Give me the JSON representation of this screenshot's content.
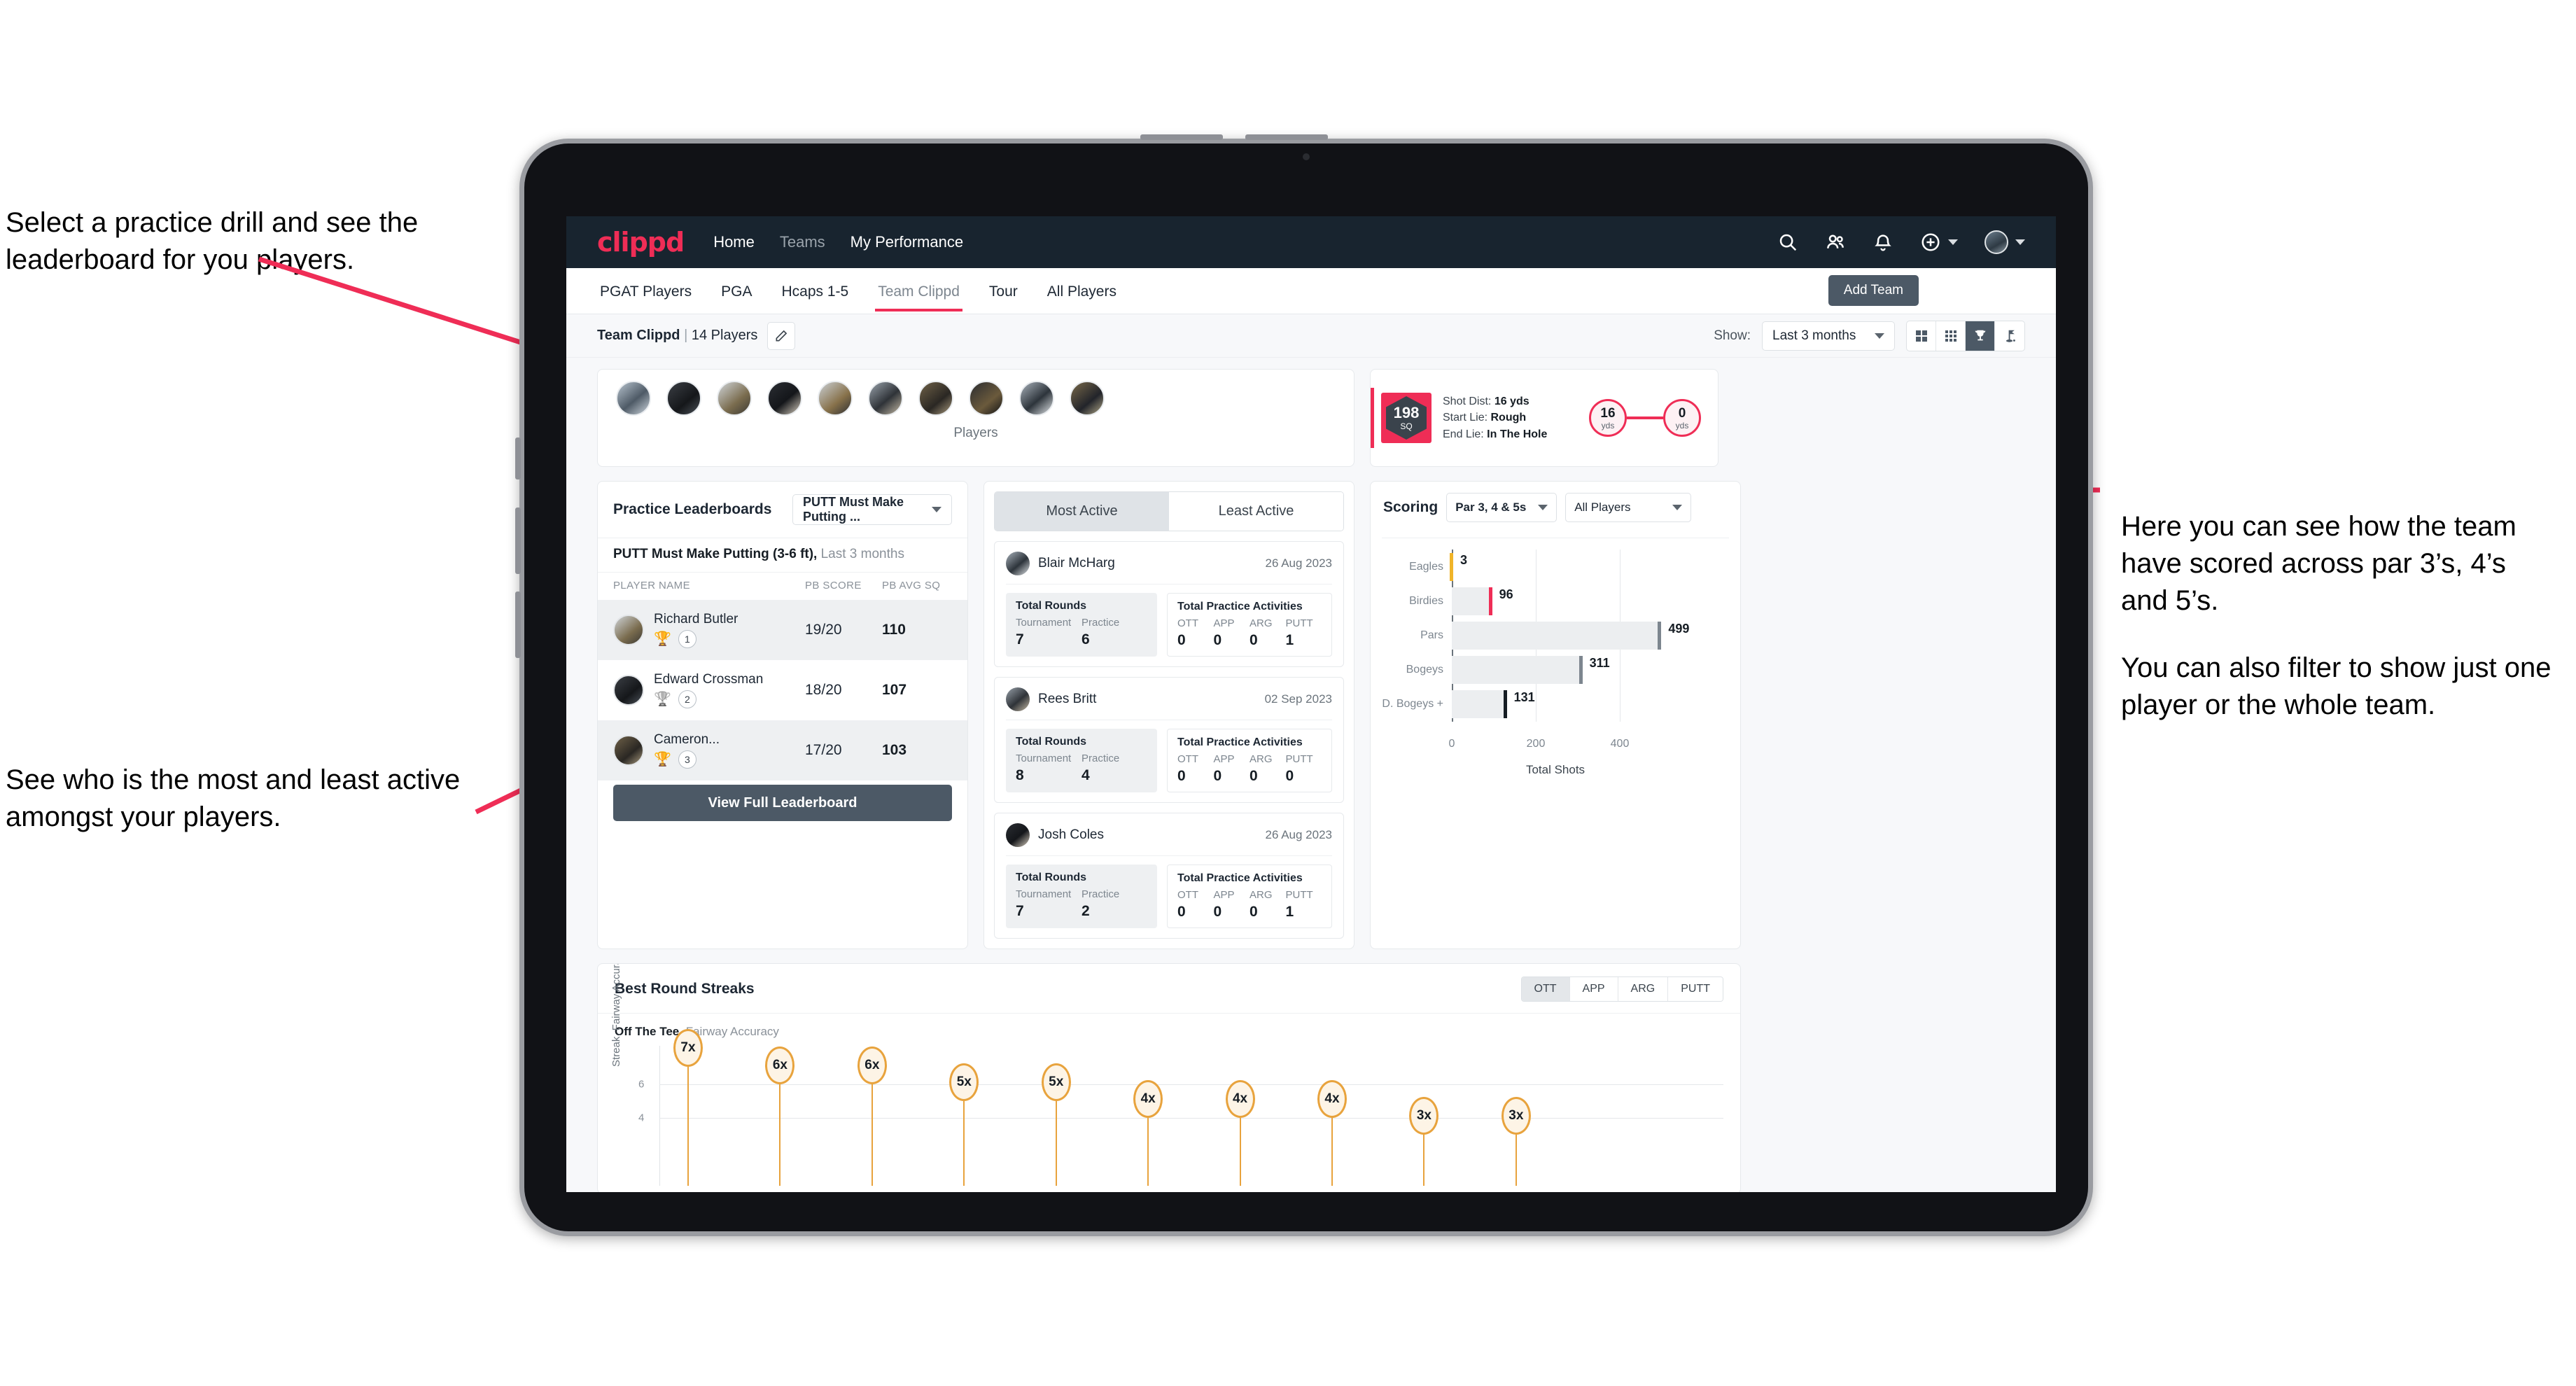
{
  "annotations": {
    "left_top": "Select a practice drill and see the leaderboard for you players.",
    "left_bottom": "See who is the most and least active amongst your players.",
    "right_1": "Here you can see how the team have scored across par 3’s, 4’s and 5’s.",
    "right_2": "You can also filter to show just one player or the whole team."
  },
  "topnav": {
    "logo": "clippd",
    "links": [
      {
        "label": "Home",
        "active": true
      },
      {
        "label": "Teams",
        "active": false
      },
      {
        "label": "My Performance",
        "active": true
      }
    ],
    "icons": [
      "search-icon",
      "people-icon",
      "bell-icon",
      "plus-circle-icon",
      "avatar"
    ]
  },
  "tabs": [
    {
      "label": "PGAT Players",
      "active": false
    },
    {
      "label": "PGA",
      "active": false
    },
    {
      "label": "Hcaps 1-5",
      "active": false
    },
    {
      "label": "Team Clippd",
      "active": true
    },
    {
      "label": "Tour",
      "active": false
    },
    {
      "label": "All Players",
      "active": false
    }
  ],
  "add_team_button": "Add Team",
  "subbar": {
    "team_name": "Team Clippd",
    "separator": "|",
    "player_count": "14 Players",
    "edit_icon": "pencil-icon",
    "show_label": "Show:",
    "range_value": "Last 3 months",
    "view_modes": [
      {
        "icon": "grid-2x2-icon",
        "active": false
      },
      {
        "icon": "grid-3x3-icon",
        "active": false
      },
      {
        "icon": "trophy-icon",
        "active": true
      },
      {
        "icon": "golf-flag-icon",
        "active": false
      }
    ]
  },
  "players_card": {
    "caption": "Players",
    "count": 10
  },
  "shot_card": {
    "sq_value": "198",
    "sq_label": "SQ",
    "shot_dist_label": "Shot Dist:",
    "shot_dist_value": "16 yds",
    "start_lie_label": "Start Lie:",
    "start_lie_value": "Rough",
    "end_lie_label": "End Lie:",
    "end_lie_value": "In The Hole",
    "start_circle_value": "16",
    "start_circle_unit": "yds",
    "end_circle_value": "0",
    "end_circle_unit": "yds"
  },
  "leaderboard": {
    "title": "Practice Leaderboards",
    "drill_select": "PUTT Must Make Putting ...",
    "subtitle_bold": "PUTT Must Make Putting (3-6 ft),",
    "subtitle_rest": " Last 3 months",
    "columns": [
      "PLAYER NAME",
      "PB SCORE",
      "PB AVG SQ"
    ],
    "rows": [
      {
        "name": "Richard Butler",
        "rank": "1",
        "trophy": "gold",
        "pb_score": "19/20",
        "pb_avg_sq": "110"
      },
      {
        "name": "Edward Crossman",
        "rank": "2",
        "trophy": "silver",
        "pb_score": "18/20",
        "pb_avg_sq": "107"
      },
      {
        "name": "Cameron...",
        "rank": "3",
        "trophy": "bronze",
        "pb_score": "17/20",
        "pb_avg_sq": "103"
      }
    ],
    "view_full_button": "View Full Leaderboard"
  },
  "activity": {
    "tabs": [
      {
        "label": "Most Active",
        "active": true
      },
      {
        "label": "Least Active",
        "active": false
      }
    ],
    "rounds_title": "Total Rounds",
    "rounds_labels": [
      "Tournament",
      "Practice"
    ],
    "acts_title": "Total Practice Activities",
    "acts_labels": [
      "OTT",
      "APP",
      "ARG",
      "PUTT"
    ],
    "players": [
      {
        "name": "Blair McHarg",
        "date": "26 Aug 2023",
        "rounds": [
          "7",
          "6"
        ],
        "acts": [
          "0",
          "0",
          "0",
          "1"
        ]
      },
      {
        "name": "Rees Britt",
        "date": "02 Sep 2023",
        "rounds": [
          "8",
          "4"
        ],
        "acts": [
          "0",
          "0",
          "0",
          "0"
        ]
      },
      {
        "name": "Josh Coles",
        "date": "26 Aug 2023",
        "rounds": [
          "7",
          "2"
        ],
        "acts": [
          "0",
          "0",
          "0",
          "1"
        ]
      }
    ]
  },
  "scoring": {
    "title": "Scoring",
    "par_filter": "Par 3, 4 & 5s",
    "player_filter": "All Players"
  },
  "streaks": {
    "title": "Best Round Streaks",
    "toggle": [
      {
        "label": "OTT",
        "active": true
      },
      {
        "label": "APP",
        "active": false
      },
      {
        "label": "ARG",
        "active": false
      },
      {
        "label": "PUTT",
        "active": false
      }
    ],
    "subtitle_bold": "Off The Tee,",
    "subtitle_rest": " Fairway Accuracy"
  },
  "chart_data": [
    {
      "type": "bar",
      "orientation": "horizontal",
      "title": "Scoring",
      "categories": [
        "Eagles",
        "Birdies",
        "Pars",
        "Bogeys",
        "D. Bogeys +"
      ],
      "values": [
        3,
        96,
        499,
        311,
        131
      ],
      "cap_colors": [
        "#f0b429",
        "#ef2d56",
        "#7d868f",
        "#7d868f",
        "#161d24"
      ],
      "xlabel": "Total Shots",
      "ylabel": "",
      "xlim": [
        0,
        560
      ],
      "xticks": [
        0,
        200,
        400
      ],
      "grid": true,
      "legend": "none"
    },
    {
      "type": "scatter",
      "title": "Best Round Streaks",
      "subtitle": "Off The Tee, Fairway Accuracy",
      "ylabel": "Streak, Fairway Accuracy",
      "xlabel": "",
      "ylim": [
        0,
        8
      ],
      "yticks": [
        4,
        6
      ],
      "labels": [
        "7x",
        "6x",
        "6x",
        "5x",
        "5x",
        "4x",
        "4x",
        "4x",
        "3x",
        "3x"
      ],
      "values": [
        7,
        6,
        6,
        5,
        5,
        4,
        4,
        4,
        3,
        3
      ],
      "marker": "lollipop",
      "marker_color": "#e8a33d",
      "grid": true
    }
  ]
}
